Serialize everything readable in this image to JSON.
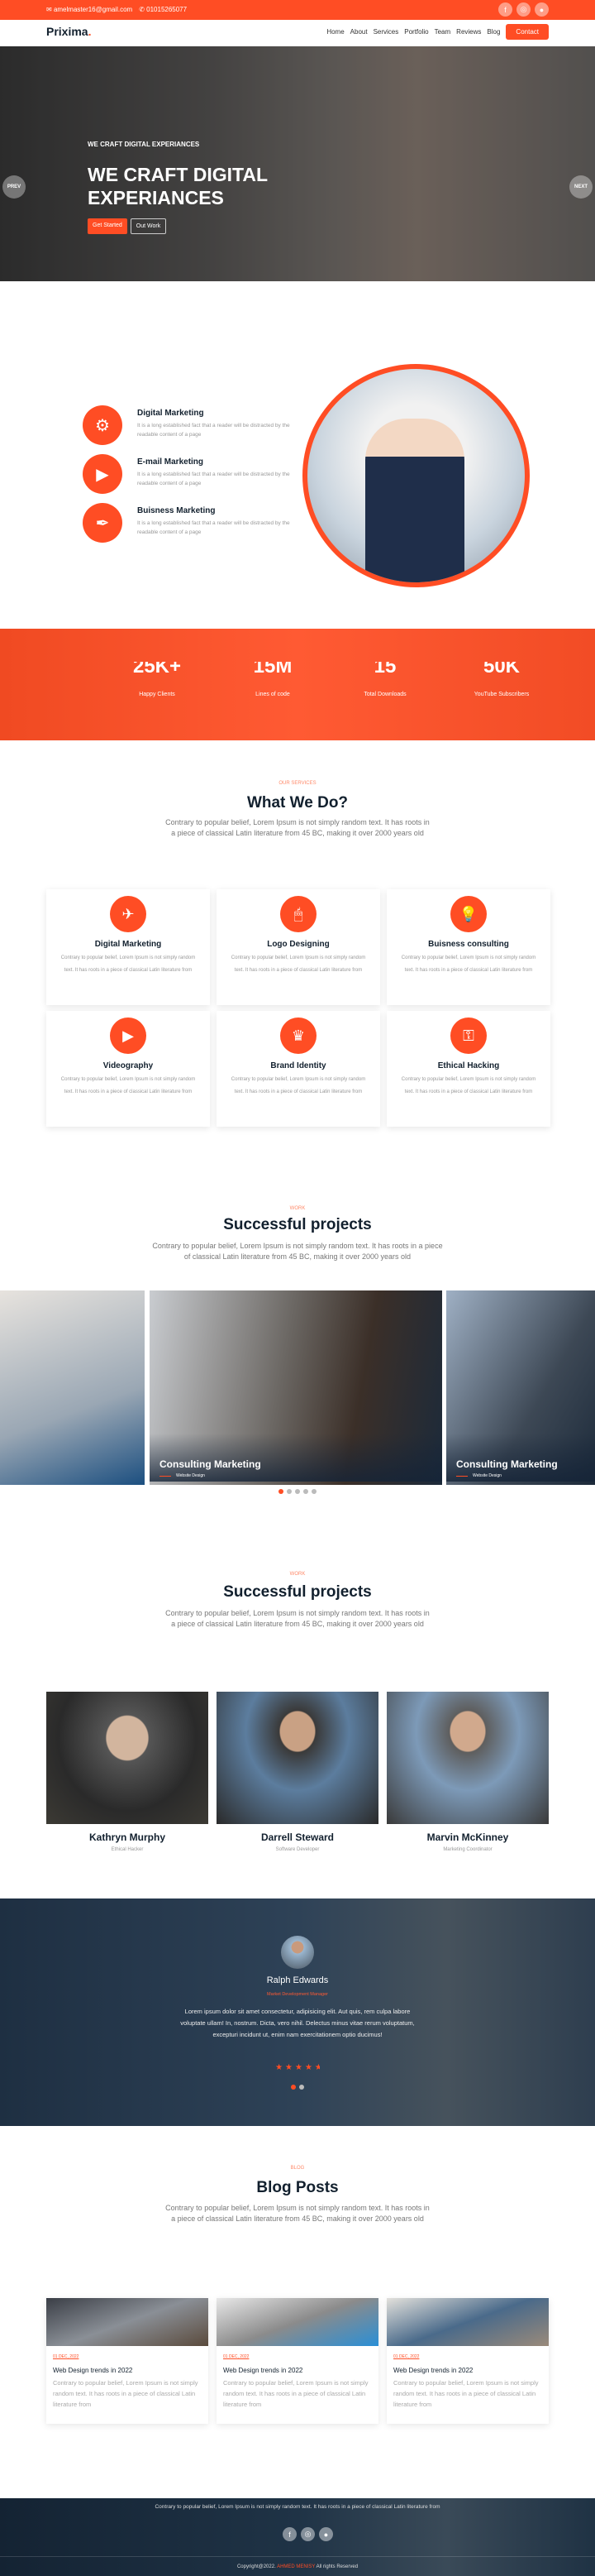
{
  "topbar": {
    "email": "amelmaster16@gmail.com",
    "phone": "01015265077",
    "social": [
      "facebook-icon",
      "instagram-icon",
      "github-icon"
    ]
  },
  "nav": {
    "logo": "Prixima",
    "logo_dot": ".",
    "items": [
      "Home",
      "About",
      "Services",
      "Portfolio",
      "Team",
      "Reviews",
      "Blog"
    ],
    "contact": "Contact"
  },
  "hero": {
    "subtitle": "WE CRAFT DIGITAL EXPERIANCES",
    "title": "WE CRAFT DIGITAL EXPERIANCES",
    "primary": "Get Started",
    "secondary": "Out Work",
    "prev": "PREV",
    "next": "NEXT"
  },
  "features": [
    {
      "title": "Digital Marketing",
      "text": "It is a long established fact that a reader will be distracted by the readable content of a page",
      "icon": "head-gears-icon"
    },
    {
      "title": "E-mail Marketing",
      "text": "It is a long established fact that a reader will be distracted by the readable content of a page",
      "icon": "video-scroll-icon"
    },
    {
      "title": "Buisness Marketing",
      "text": "It is a long established fact that a reader will be distracted by the readable content of a page",
      "icon": "pen-nib-icon"
    }
  ],
  "stats": [
    {
      "number": "25K+",
      "label": "Happy Clients"
    },
    {
      "number": "15M",
      "label": "Lines of code"
    },
    {
      "number": "15",
      "label": "Total Downloads"
    },
    {
      "number": "50K",
      "label": "YouTube Subscribers"
    }
  ],
  "services": {
    "label": "OUR SERVICES",
    "title": "What We Do?",
    "text": "Contrary to popular belief, Lorem Ipsum is not simply random text. It has roots in a piece of classical Latin literature from 45 BC, making it over 2000 years old",
    "cards": [
      {
        "title": "Digital Marketing",
        "text": "Contrary to popular belief, Lorem Ipsum is not simply random text. It has roots in a piece of classical Latin literature from"
      },
      {
        "title": "Logo Designing",
        "text": "Contrary to popular belief, Lorem Ipsum is not simply random text. It has roots in a piece of classical Latin literature from"
      },
      {
        "title": "Buisness consulting",
        "text": "Contrary to popular belief, Lorem Ipsum is not simply random text. It has roots in a piece of classical Latin literature from"
      },
      {
        "title": "Videography",
        "text": "Contrary to popular belief, Lorem Ipsum is not simply random text. It has roots in a piece of classical Latin literature from"
      },
      {
        "title": "Brand Identity",
        "text": "Contrary to popular belief, Lorem Ipsum is not simply random text. It has roots in a piece of classical Latin literature from"
      },
      {
        "title": "Ethical Hacking",
        "text": "Contrary to popular belief, Lorem Ipsum is not simply random text. It has roots in a piece of classical Latin literature from"
      }
    ]
  },
  "projects": {
    "label": "WORK",
    "title": "Successful projects",
    "text": "Contrary to popular belief, Lorem Ipsum is not simply random text. It has roots in a piece of classical Latin literature from 45 BC, making it over 2000 years old",
    "slides": [
      {
        "title": "Consulting Marketing",
        "tag": "Website Design"
      },
      {
        "title": "Consulting Marketing",
        "tag": "Website Design"
      }
    ],
    "active_dot": 1,
    "dot_count": 5
  },
  "team": {
    "label": "WORK",
    "title": "Successful projects",
    "text": "Contrary to popular belief, Lorem Ipsum is not simply random text. It has roots in a piece of classical Latin literature from 45 BC, making it over 2000 years old",
    "members": [
      {
        "name": "Kathryn Murphy",
        "role": "Ethical Hacker"
      },
      {
        "name": "Darrell Steward",
        "role": "Software Developer"
      },
      {
        "name": "Marvin McKinney",
        "role": "Marketing Coordinator"
      }
    ]
  },
  "testimonial": {
    "name": "Ralph Edwards",
    "role": "Market Development Manager",
    "text": "Lorem ipsum dolor sit amet consectetur, adipisicing elit. Aut quis, rem culpa labore voluptate ullam! In, nostrum. Dicta, vero nihil. Delectus minus vitae rerum voluptatum, excepturi incidunt ut, enim nam exercitationem optio ducimus!",
    "rating": 4.5
  },
  "blog": {
    "label": "BLOG",
    "title": "Blog Posts",
    "text": "Contrary to popular belief, Lorem Ipsum is not simply random text. It has roots in a piece of classical Latin literature from 45 BC, making it over 2000 years old",
    "posts": [
      {
        "date": "01 DEC, 2022",
        "title": "Web Design trends in 2022",
        "text": "Contrary to popular belief, Lorem Ipsum is not simply random text. It has roots in a piece of classical Latin literature from"
      },
      {
        "date": "01 DEC, 2022",
        "title": "Web Design trends in 2022",
        "text": "Contrary to popular belief, Lorem Ipsum is not simply random text. It has roots in a piece of classical Latin literature from"
      },
      {
        "date": "01 DEC, 2022",
        "title": "Web Design trends in 2022",
        "text": "Contrary to popular belief, Lorem Ipsum is not simply random text. It has roots in a piece of classical Latin literature from"
      }
    ]
  },
  "footer": {
    "text": "Contrary to popular belief, Lorem Ipsum is not simply random text. It has roots in a piece of classical Latin literature from",
    "copy_pre": "Copyright@2022.",
    "copy_name": "AHMED MENISY",
    "copy_post": "All rights Reserved"
  },
  "colors": {
    "accent": "#ff4d24",
    "dark": "#12202e"
  }
}
